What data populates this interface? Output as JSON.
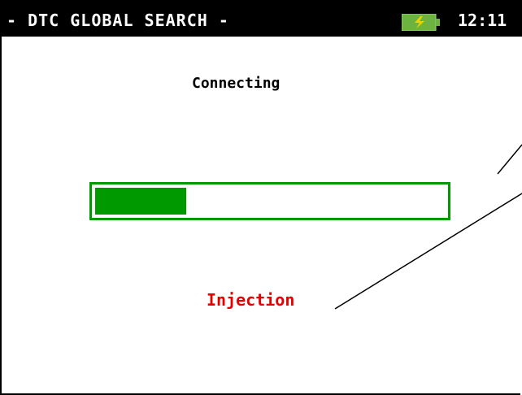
{
  "header": {
    "title": "- DTC GLOBAL SEARCH -",
    "clock": "12:11",
    "battery_icon": "battery-charging-icon"
  },
  "main": {
    "status_text": "Connecting",
    "progress_fraction": 0.26,
    "current_module": "Injection"
  },
  "colors": {
    "header_bg": "#000000",
    "progress_green": "#009900",
    "module_text_red": "#e60000"
  }
}
